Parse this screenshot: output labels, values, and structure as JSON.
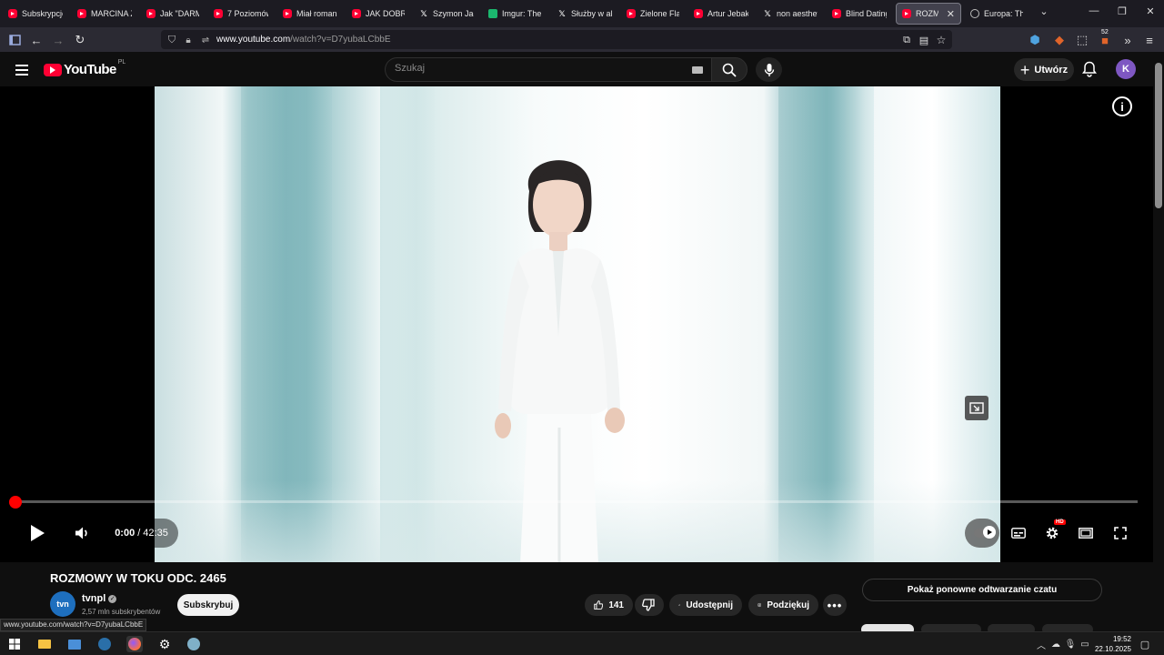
{
  "browser": {
    "tabs": [
      {
        "label": "Subskrypcje",
        "icon": "youtube-icon"
      },
      {
        "label": "MARCINA ZA",
        "icon": "youtube-icon"
      },
      {
        "label": "Jak \"DARMO",
        "icon": "youtube-icon"
      },
      {
        "label": "7 Poziomów",
        "icon": "youtube-icon"
      },
      {
        "label": "Miał romans",
        "icon": "youtube-icon"
      },
      {
        "label": "JAK DOBRZE",
        "icon": "youtube-icon"
      },
      {
        "label": "Szymon Jadc",
        "icon": "x-icon"
      },
      {
        "label": "Imgur: The m",
        "icon": "imgur-icon"
      },
      {
        "label": "Służby w akc",
        "icon": "x-icon"
      },
      {
        "label": "Zielone Flag",
        "icon": "youtube-icon"
      },
      {
        "label": "Artur Jebaka",
        "icon": "youtube-icon"
      },
      {
        "label": "non aesthetic",
        "icon": "x-icon"
      },
      {
        "label": "Blind Dating",
        "icon": "youtube-icon"
      },
      {
        "label": "ROZMOW",
        "icon": "youtube-icon",
        "active": true
      },
      {
        "label": "Europa: The",
        "icon": "globe-icon"
      }
    ],
    "url_host": "www.youtube.com",
    "url_path": "/watch?v=D7yubaLCbbE",
    "extension_badge": "52",
    "status_url": "www.youtube.com/watch?v=D7yubaLCbbE"
  },
  "youtube": {
    "logo_text": "YouTube",
    "region": "PL",
    "search_placeholder": "Szukaj",
    "create_label": "Utwórz",
    "avatar_letter": "K"
  },
  "player": {
    "current_time": "0:00",
    "separator": "/",
    "duration": "42:35",
    "progress_fraction": 0.0,
    "quality_badge": "HD",
    "autoplay_on": true
  },
  "video": {
    "title": "ROZMOWY W TOKU ODC. 2465",
    "channel_name": "tvnpl",
    "channel_logo_text": "tvn",
    "subscribers": "2,57 mln subskrybentów",
    "subscribe_label": "Subskrybuj",
    "like_count": "141",
    "share_label": "Udostępnij",
    "thanks_label": "Podziękuj",
    "chat_replay_label": "Pokaż ponowne odtwarzanie czatu"
  },
  "taskbar": {
    "time": "19:52",
    "date": "22.10.2025"
  },
  "colors": {
    "yt_red": "#ff0033",
    "background": "#0f0f0f",
    "browser_tabstrip": "#1c1b22",
    "browser_navbar": "#2b2a33",
    "avatar": "#7e57c2"
  }
}
